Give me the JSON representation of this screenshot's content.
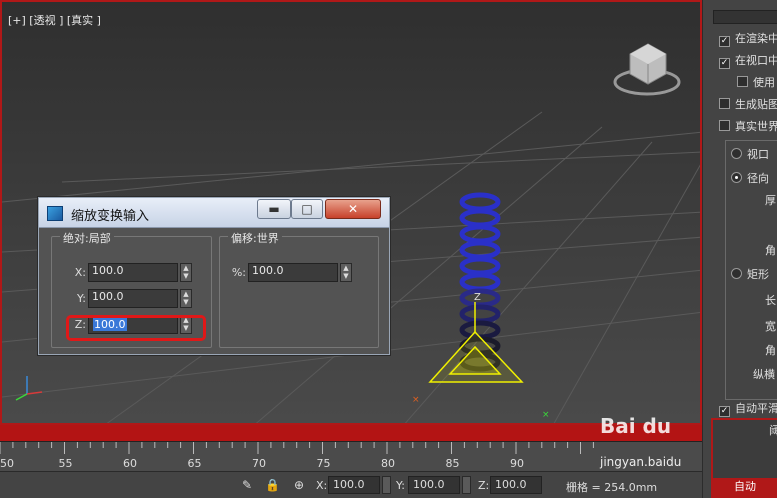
{
  "viewport": {
    "label": "[+] [透视 ] [真实 ]",
    "gizmo_axis_label": "Z"
  },
  "dialog": {
    "title": "缩放变换输入",
    "btn_min": "▬",
    "btn_max": "□",
    "btn_close": "✕",
    "absolute_group": {
      "label": "绝对:局部",
      "x_label": "X:",
      "x_value": "100.0",
      "y_label": "Y:",
      "y_value": "100.0",
      "z_label": "Z:",
      "z_value": "100.0"
    },
    "offset_group": {
      "label": "偏移:世界",
      "pct_label": "%:",
      "pct_value": "100.0"
    }
  },
  "right_panel": {
    "items": [
      "在渲染中",
      "在视口中",
      "使用",
      "生成贴图",
      "真实世界",
      "视口",
      "径向",
      "厚",
      "角",
      "矩形",
      "长",
      "宽",
      "角",
      "纵横",
      "自动平滑",
      "阈",
      "自动"
    ]
  },
  "timeline": {
    "ticks": [
      "50",
      "55",
      "60",
      "65",
      "70",
      "75",
      "80",
      "85",
      "90"
    ]
  },
  "status": {
    "x_label": "X:",
    "x_value": "100.0",
    "y_label": "Y:",
    "y_value": "100.0",
    "z_label": "Z:",
    "z_value": "100.0",
    "grid": "栅格 = 254.0mm"
  },
  "watermark": {
    "brand": "Bai du",
    "sub": "jingyan.baidu"
  },
  "colors": {
    "highlight": "#e01818",
    "selection": "#3a78d8",
    "spring": "#2a30c8",
    "gizmo": "#f0f000"
  }
}
